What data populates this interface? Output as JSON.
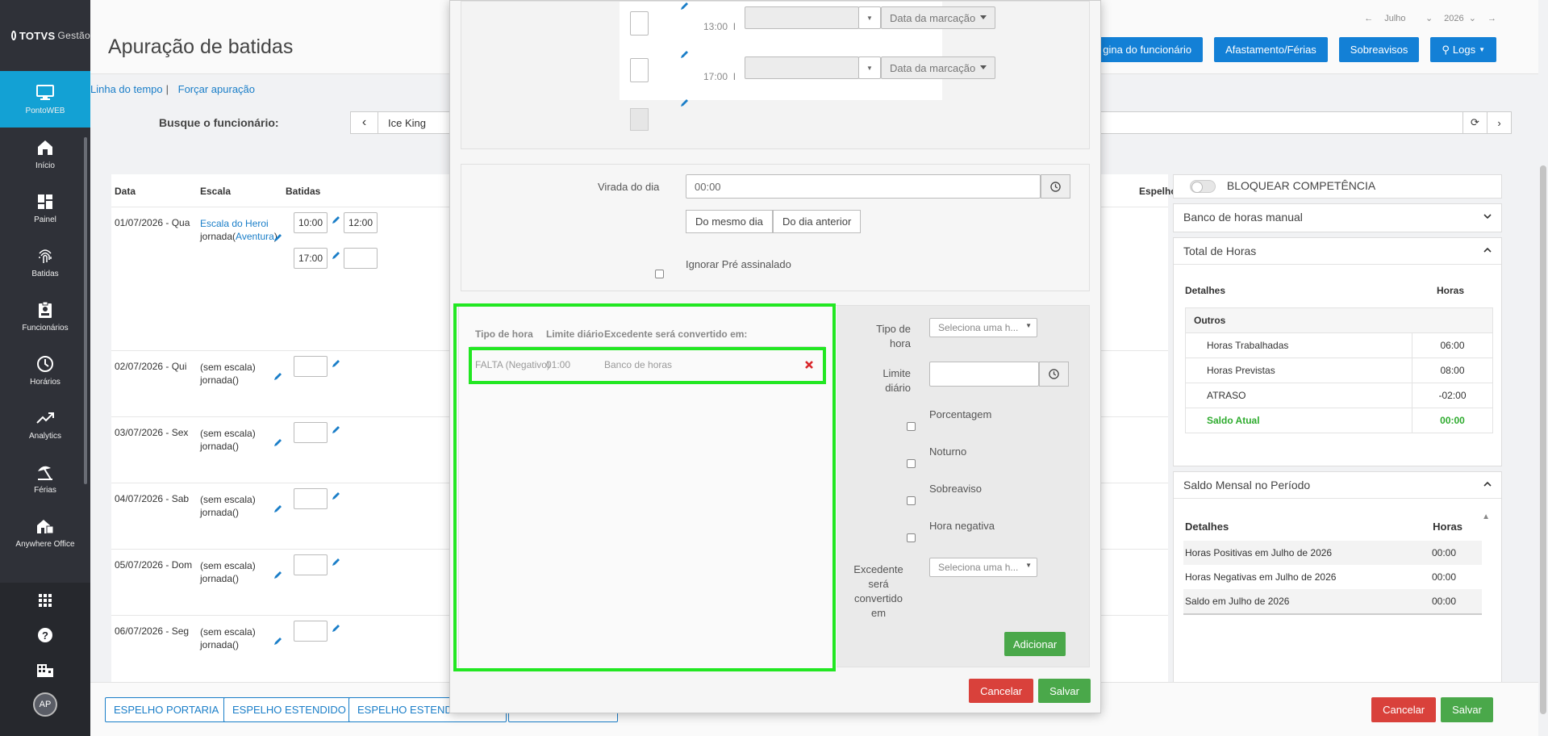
{
  "sidebar": {
    "brand": "TOTVS",
    "brand_sub": "Gestão",
    "items": [
      {
        "label": "PontoWEB",
        "icon": "monitor-icon",
        "active": true
      },
      {
        "label": "Início",
        "icon": "home-icon"
      },
      {
        "label": "Painel",
        "icon": "dashboard-icon"
      },
      {
        "label": "Batidas",
        "icon": "fingerprint-icon"
      },
      {
        "label": "Funcionários",
        "icon": "badge-icon"
      },
      {
        "label": "Horários",
        "icon": "clock-icon"
      },
      {
        "label": "Analytics",
        "icon": "trending-up-icon"
      },
      {
        "label": "Férias",
        "icon": "beach-umbrella-icon"
      },
      {
        "label": "Anywhere Office",
        "icon": "house-work-icon"
      }
    ],
    "bottom": {
      "apps": "apps-grid-icon",
      "help": "help-icon",
      "company": "building-icon",
      "avatar": "AP"
    }
  },
  "header": {
    "title": "Apuração de batidas",
    "month": "Julho",
    "year": "2026",
    "buttons": [
      "gina do funcionário",
      "Afastamento/Férias",
      "Sobreavisos",
      "Logs"
    ]
  },
  "links": {
    "timeline": "Linha do tempo",
    "force": "Forçar apuração"
  },
  "search": {
    "label": "Busque o funcionário:",
    "employee": "Ice King"
  },
  "table": {
    "headers": {
      "date": "Data",
      "scale": "Escala",
      "punches": "Batidas",
      "mirror": "Espelho"
    },
    "rows": [
      {
        "date": "01/07/2026 - Qua",
        "scale_link": "Escala do Heroi",
        "journey_prefix": "jornada(",
        "journey_link": "Aventura",
        "journey_suffix": ")",
        "t1": "10:00",
        "t2": "12:00",
        "t3": "17:00",
        "t4": ""
      },
      {
        "date": "02/07/2026 - Qui",
        "scale": "(sem escala)",
        "journey": "jornada()"
      },
      {
        "date": "03/07/2026 - Sex",
        "scale": "(sem escala)",
        "journey": "jornada()"
      },
      {
        "date": "04/07/2026 - Sab",
        "scale": "(sem escala)",
        "journey": "jornada()"
      },
      {
        "date": "05/07/2026 - Dom",
        "scale": "(sem escala)",
        "journey": "jornada()"
      },
      {
        "date": "06/07/2026 - Seg",
        "scale": "(sem escala)",
        "journey": "jornada()"
      }
    ]
  },
  "right": {
    "lock": "BLOQUEAR COMPETÊNCIA",
    "manual_bank": "Banco de horas manual",
    "total_title": "Total de Horas",
    "total_headers": {
      "details": "Detalhes",
      "hours": "Horas"
    },
    "total_group": "Outros",
    "total_rows": [
      {
        "label": "Horas Trabalhadas",
        "value": "06:00"
      },
      {
        "label": "Horas Previstas",
        "value": "08:00"
      },
      {
        "label": "ATRASO",
        "value": "-02:00"
      },
      {
        "label": "Saldo Atual",
        "value": "00:00"
      }
    ],
    "monthly_title": "Saldo Mensal no Período",
    "monthly_headers": {
      "details": "Detalhes",
      "hours": "Horas"
    },
    "monthly_rows": [
      {
        "label": "Horas Positivas em Julho de 2026",
        "value": "00:00"
      },
      {
        "label": "Horas Negativas em Julho de 2026",
        "value": "00:00"
      },
      {
        "label": "Saldo em Julho de 2026",
        "value": "00:00"
      }
    ]
  },
  "bottom": {
    "btn1": "ESPELHO PORTARIA",
    "btn2": "ESPELHO ESTENDIDO",
    "btn3": "ESPELHO ESTENDI",
    "cancel": "Cancelar",
    "save": "Salvar"
  },
  "modal": {
    "punch_rows": [
      {
        "time": "13:00",
        "sep": "I",
        "type": "Data da marcação"
      },
      {
        "time": "17:00",
        "sep": "I",
        "type": "Data da marcação"
      }
    ],
    "day_turn_label": "Virada do dia",
    "day_turn_value": "00:00",
    "same_day": "Do mesmo dia",
    "prev_day": "Do dia anterior",
    "ignore_pre": "Ignorar Pré assinalado",
    "tipo_headers": {
      "type": "Tipo de hora",
      "limit": "Limite diário",
      "excess": "Excedente será convertido em:"
    },
    "tipo_row": {
      "type": "FALTA (Negativo)",
      "limit": "01:00",
      "excess": "Banco de horas"
    },
    "form": {
      "tipo_label_1": "Tipo de",
      "tipo_label_2": "hora",
      "tipo_placeholder": "Seleciona uma h...",
      "limit_label_1": "Limite",
      "limit_label_2": "diário",
      "percent": "Porcentagem",
      "night": "Noturno",
      "standby": "Sobreaviso",
      "negative": "Hora negativa",
      "excess_label_1": "Excedente",
      "excess_label_2": "será",
      "excess_label_3": "convertido",
      "excess_label_4": "em",
      "excess_placeholder": "Seleciona uma h...",
      "add": "Adicionar"
    },
    "cancel": "Cancelar",
    "save": "Salvar"
  },
  "colors": {
    "accent": "#13a1d4",
    "primary": "#1380d6",
    "danger": "#d9413b",
    "success": "#4aa84a",
    "highlight": "#22e722",
    "saldo": "#2eab2e"
  }
}
